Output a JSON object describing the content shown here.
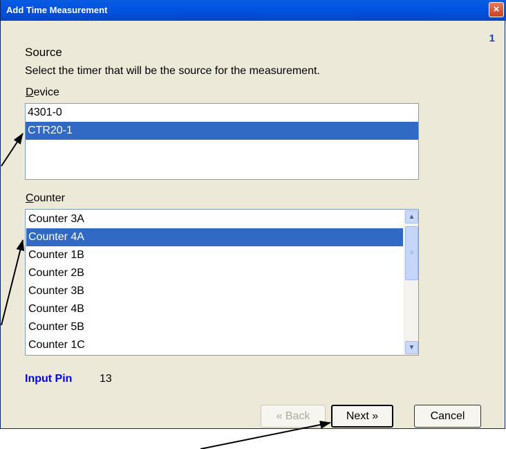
{
  "window": {
    "title": "Add Time Measurement",
    "close_icon": "×",
    "page_number": "1"
  },
  "source": {
    "heading": "Source",
    "description": "Select the timer that will be the source for the measurement."
  },
  "device": {
    "label": "Device",
    "items": [
      {
        "label": "4301-0",
        "selected": false
      },
      {
        "label": "CTR20-1",
        "selected": true
      }
    ]
  },
  "counter": {
    "label": "Counter",
    "items": [
      {
        "label": "Counter 3A",
        "selected": false
      },
      {
        "label": "Counter 4A",
        "selected": true
      },
      {
        "label": "Counter 1B",
        "selected": false
      },
      {
        "label": "Counter 2B",
        "selected": false
      },
      {
        "label": "Counter 3B",
        "selected": false
      },
      {
        "label": "Counter 4B",
        "selected": false
      },
      {
        "label": "Counter 5B",
        "selected": false
      },
      {
        "label": "Counter 1C",
        "selected": false
      }
    ]
  },
  "input_pin": {
    "label": "Input Pin",
    "value": "13"
  },
  "buttons": {
    "back": "« Back",
    "next": "Next »",
    "cancel": "Cancel"
  },
  "colors": {
    "selection": "#316ac5",
    "title_bar": "#0054e3",
    "dialog_bg": "#ece9d8",
    "pin_label": "#0000ff"
  }
}
